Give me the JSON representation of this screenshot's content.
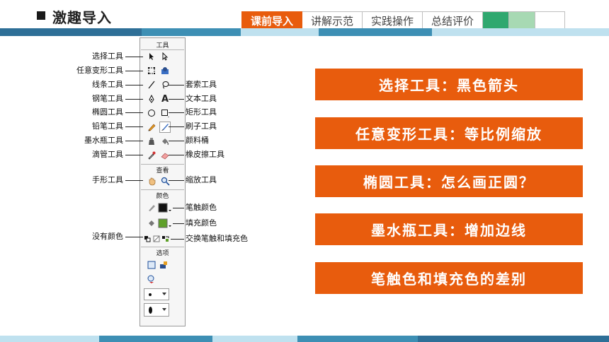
{
  "header": {
    "title": "激趣导入",
    "tabs": [
      {
        "label": "课前导入",
        "active": true
      },
      {
        "label": "讲解示范",
        "active": false
      },
      {
        "label": "实践操作",
        "active": false
      },
      {
        "label": "总结评价",
        "active": false
      }
    ]
  },
  "colors": {
    "accent": "#e85c0d",
    "band_dark": "#2e6f97",
    "band_mid": "#3d8fb4",
    "band_light": "#bfe1ef",
    "tab_green": "#2fa86f",
    "tab_light_green": "#a7d9b3"
  },
  "toolbox": {
    "headers": {
      "tools": "工具",
      "view": "查看",
      "colors": "颜色",
      "options": "选项"
    }
  },
  "labels_left": [
    "选择工具",
    "任意变形工具",
    "线条工具",
    "钢笔工具",
    "椭圆工具",
    "铅笔工具",
    "墨水瓶工具",
    "滴管工具",
    "手形工具",
    "没有颜色"
  ],
  "labels_right": [
    "套索工具",
    "文本工具",
    "矩形工具",
    "刷子工具",
    "颜料桶",
    "橡皮擦工具",
    "缩放工具",
    "笔触颜色",
    "填充颜色",
    "交换笔触和填充色"
  ],
  "callouts": [
    "选择工具：黑色箭头",
    "任意变形工具：等比例缩放",
    "椭圆工具：怎么画正圆？",
    "墨水瓶工具：增加边线",
    "笔触色和填充色的差别"
  ],
  "icons": [
    "arrow-select-icon",
    "subselect-icon",
    "free-transform-icon",
    "fill-transform-icon",
    "line-icon",
    "lasso-icon",
    "pen-icon",
    "text-icon",
    "oval-icon",
    "rectangle-icon",
    "pencil-icon",
    "brush-icon",
    "ink-bottle-icon",
    "paint-bucket-icon",
    "eyedropper-icon",
    "eraser-icon",
    "hand-icon",
    "zoom-icon"
  ]
}
